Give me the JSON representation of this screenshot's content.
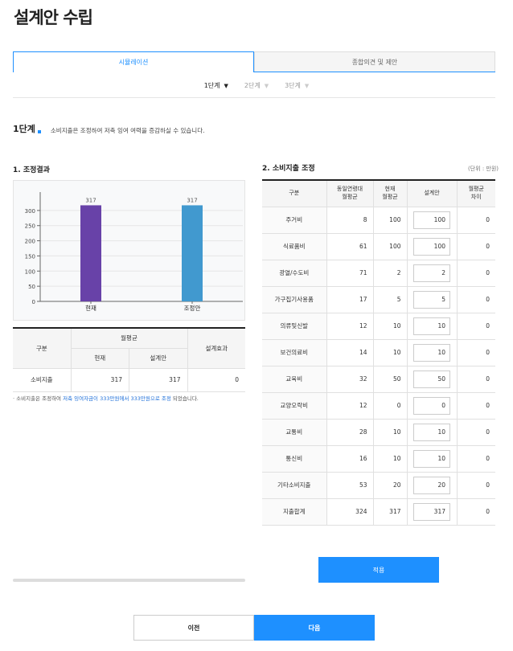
{
  "page_title": "설계안 수립",
  "tabs": [
    {
      "label": "시뮬레이션",
      "active": true
    },
    {
      "label": "종합의견 및 제안",
      "active": false
    }
  ],
  "steps": [
    {
      "label": "1단계",
      "active": true
    },
    {
      "label": "2단계",
      "active": false
    },
    {
      "label": "3단계",
      "active": false
    }
  ],
  "stage": {
    "label": "1단계",
    "description": "소비지출은 조정하여 저축 잉여 여력을 증감하실 수 있습니다."
  },
  "section1": {
    "title": "1. 조정결과",
    "table": {
      "header_category": "구분",
      "header_monthly_avg": "월평균",
      "header_current": "현재",
      "header_design": "설계안",
      "header_effect": "설계효과",
      "row": {
        "category": "소비지출",
        "current": "317",
        "design": "317",
        "effect": "0"
      }
    },
    "note_prefix": "소비지출은 조정하여 ",
    "note_highlight": "저축 잉여자금이 333만원에서 333만원으로 조정",
    "note_suffix": " 되었습니다."
  },
  "chart_data": {
    "type": "bar",
    "categories": [
      "현재",
      "조정안"
    ],
    "values": [
      317,
      317
    ],
    "data_labels": [
      "317",
      "317"
    ],
    "ylim": [
      0,
      350
    ],
    "yticks": [
      0,
      50,
      100,
      150,
      200,
      250,
      300
    ],
    "colors": [
      "#6842a8",
      "#4199cf"
    ],
    "title": "",
    "xlabel": "",
    "ylabel": ""
  },
  "section2": {
    "title": "2. 소비지출 조정",
    "unit": "(단위 : 만원)",
    "headers": {
      "category": "구분",
      "peer_avg_1": "동일연령대",
      "peer_avg_2": "월평균",
      "current_1": "현재",
      "current_2": "월평균",
      "design": "설계안",
      "diff_1": "월평균",
      "diff_2": "차이"
    },
    "rows": [
      {
        "category": "주거비",
        "peer": "8",
        "current": "100",
        "design": "100",
        "diff": "0"
      },
      {
        "category": "식료품비",
        "peer": "61",
        "current": "100",
        "design": "100",
        "diff": "0"
      },
      {
        "category": "광열/수도비",
        "peer": "71",
        "current": "2",
        "design": "2",
        "diff": "0"
      },
      {
        "category": "가구집기사용품",
        "peer": "17",
        "current": "5",
        "design": "5",
        "diff": "0"
      },
      {
        "category": "의류및신발",
        "peer": "12",
        "current": "10",
        "design": "10",
        "diff": "0"
      },
      {
        "category": "보건의료비",
        "peer": "14",
        "current": "10",
        "design": "10",
        "diff": "0"
      },
      {
        "category": "교육비",
        "peer": "32",
        "current": "50",
        "design": "50",
        "diff": "0"
      },
      {
        "category": "교양오락비",
        "peer": "12",
        "current": "0",
        "design": "0",
        "diff": "0"
      },
      {
        "category": "교통비",
        "peer": "28",
        "current": "10",
        "design": "10",
        "diff": "0"
      },
      {
        "category": "통신비",
        "peer": "16",
        "current": "10",
        "design": "10",
        "diff": "0"
      },
      {
        "category": "기타소비지출",
        "peer": "53",
        "current": "20",
        "design": "20",
        "diff": "0"
      },
      {
        "category": "지출합계",
        "peer": "324",
        "current": "317",
        "design": "317",
        "diff": "0"
      }
    ],
    "apply_label": "적용"
  },
  "nav": {
    "prev_label": "이전",
    "next_label": "다음"
  }
}
